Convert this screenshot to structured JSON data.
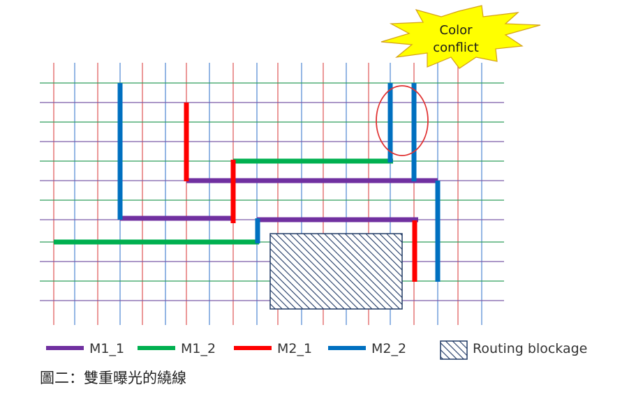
{
  "callout": {
    "line1": "Color",
    "line2": "conflict"
  },
  "legend": [
    {
      "label": "M1_1",
      "color": "#7030a0"
    },
    {
      "label": "M1_2",
      "color": "#00b050"
    },
    {
      "label": "M2_1",
      "color": "#ff0000"
    },
    {
      "label": "M2_2",
      "color": "#0070c0"
    }
  ],
  "blockage": {
    "label": "Routing blockage",
    "pattern_color": "#1f3864"
  },
  "caption": "圖二：雙重曝光的繞線",
  "colors": {
    "grid_vertical_a": "#e06060",
    "grid_vertical_b": "#5b8fd6",
    "grid_horizontal_a": "#2e9e5b",
    "grid_horizontal_b": "#7b5aa6",
    "burst_fill": "#ffff00",
    "burst_stroke": "#d4a017",
    "conflict_ring": "#e03030"
  }
}
